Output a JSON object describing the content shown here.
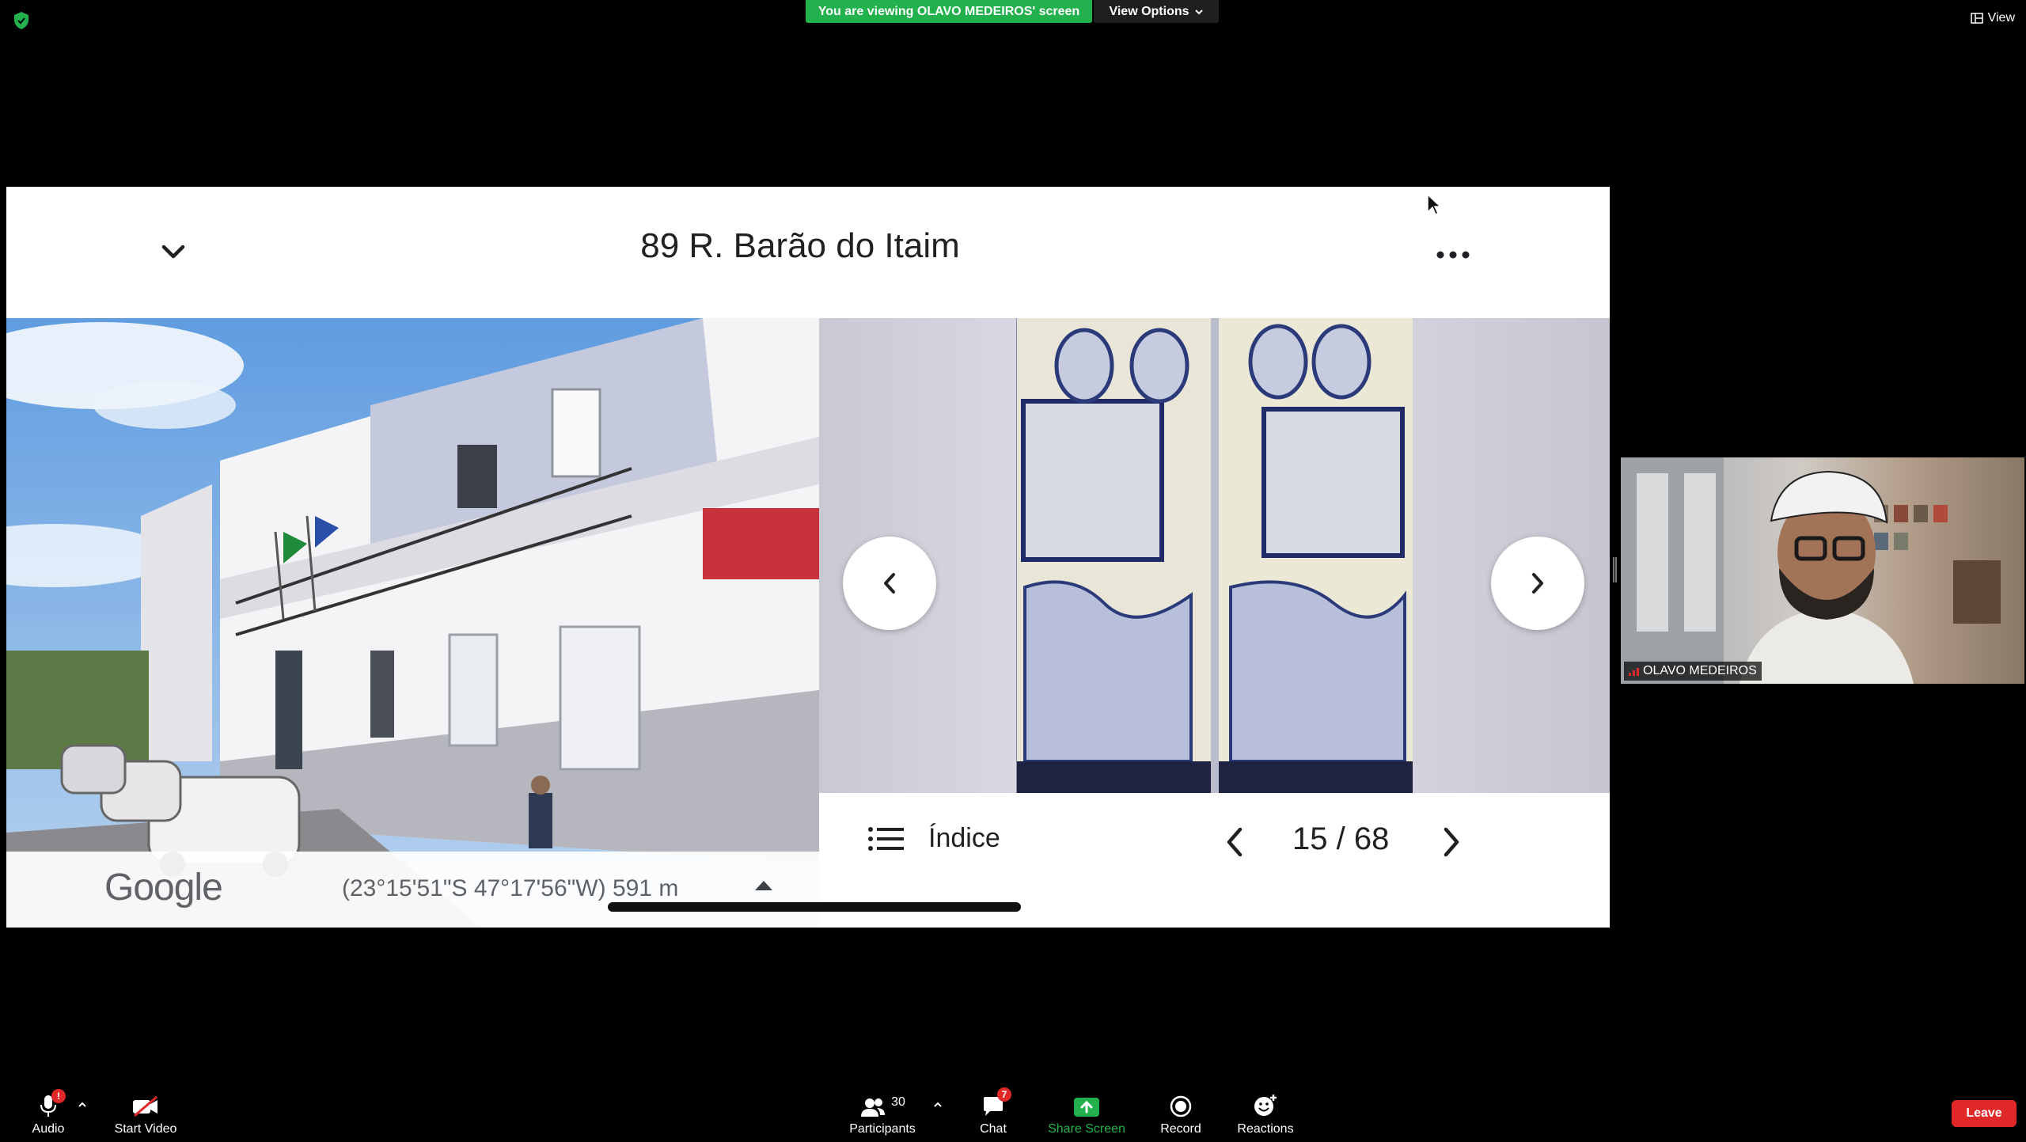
{
  "meeting": {
    "viewing_banner": "You are viewing OLAVO MEDEIROS' screen",
    "view_options_label": "View Options",
    "view_label": "View"
  },
  "shared_screen": {
    "place_title": "89 R. Barão do Itaim",
    "street_view": {
      "logo_text": "Google",
      "coordinates": "(23°15'51\"S 47°17'56\"W) 591 m"
    },
    "gallery": {
      "index_label": "Índice",
      "page_counter": "15 / 68"
    }
  },
  "participant": {
    "name": "OLAVO MEDEIROS"
  },
  "toolbar": {
    "audio_label": "Audio",
    "audio_badge": "!",
    "video_label": "Start Video",
    "participants_label": "Participants",
    "participants_count": "30",
    "chat_label": "Chat",
    "chat_badge": "7",
    "share_label": "Share Screen",
    "record_label": "Record",
    "reactions_label": "Reactions",
    "leave_label": "Leave"
  },
  "colors": {
    "share_green": "#22b14c",
    "leave_red": "#e02828",
    "gallery_blue": "#2b3b7a"
  }
}
